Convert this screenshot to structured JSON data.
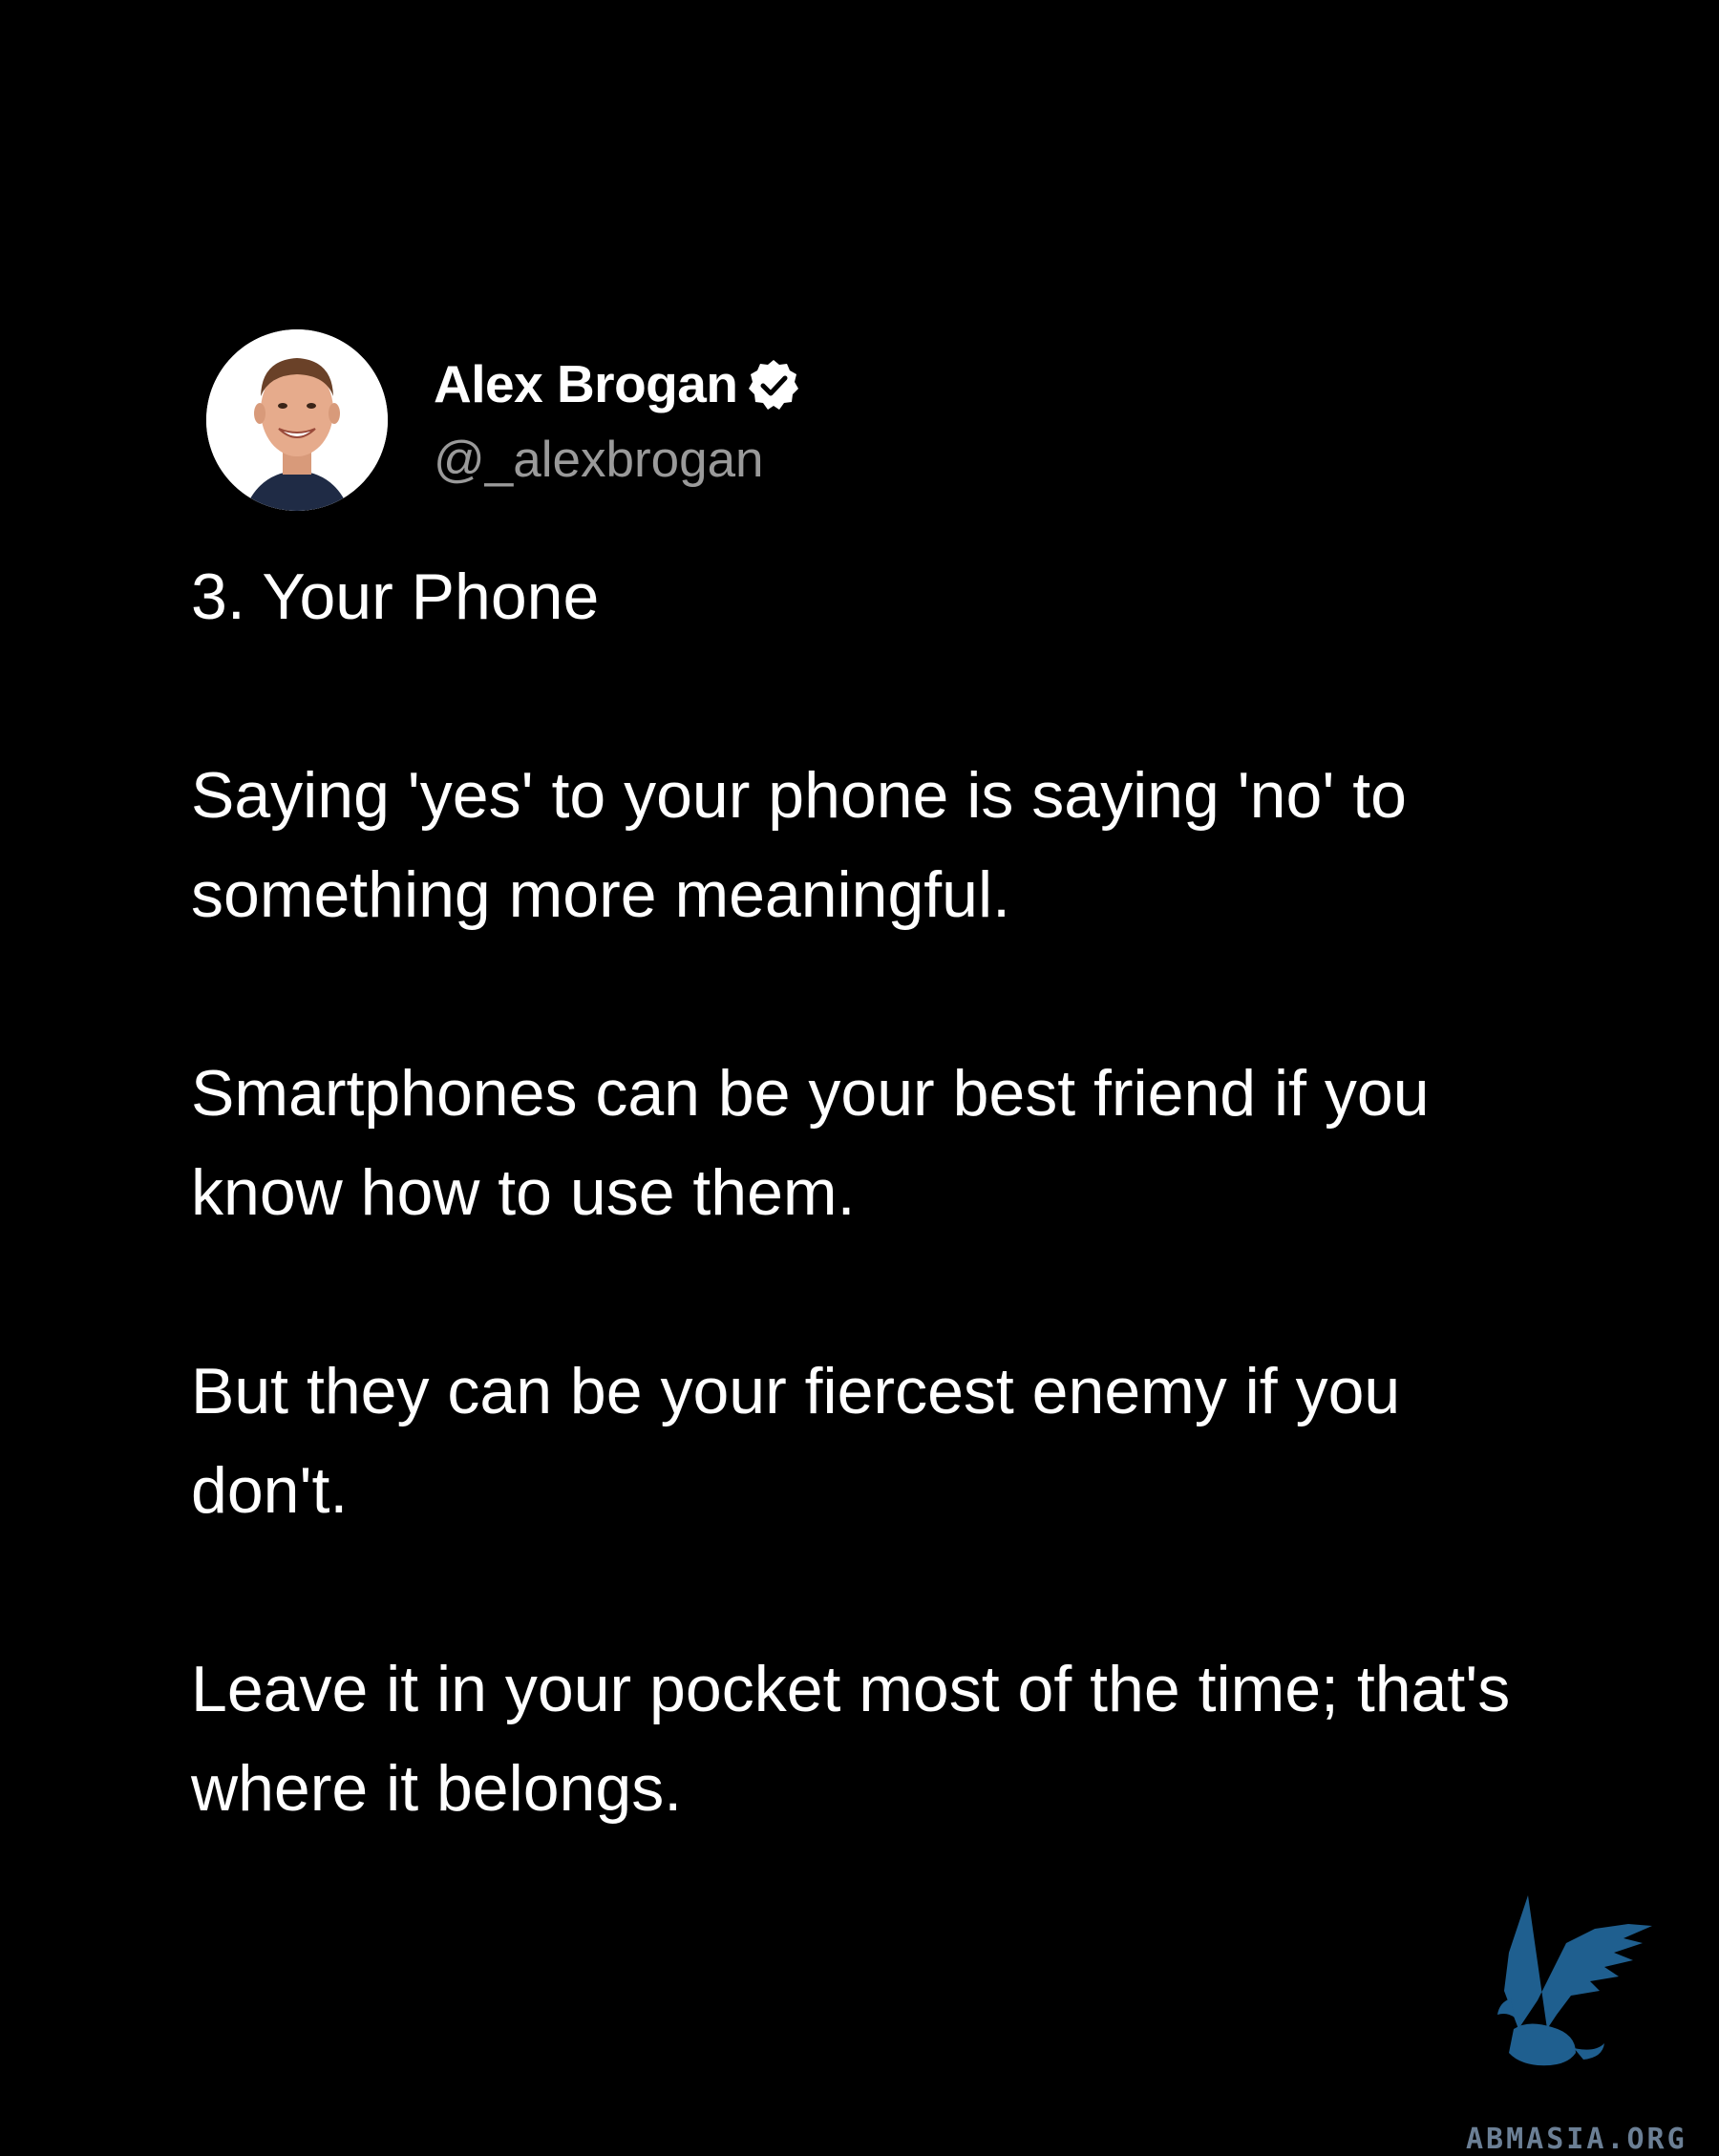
{
  "author": {
    "name": "Alex Brogan",
    "handle": "@_alexbrogan",
    "verified_icon": "verified-badge-icon",
    "avatar": "profile-photo"
  },
  "post": {
    "title": "3. Your Phone",
    "paragraphs": [
      "Saying 'yes' to your phone is saying 'no' to something more meaningful.",
      "Smartphones can be your best friend if you know how to use them.",
      "But they can be your fiercest enemy if you don't.",
      "Leave it in your pocket most of the time; that's where it belongs."
    ]
  },
  "watermark": {
    "text": "ABMASIA.ORG",
    "icon": "griffin-logo-icon"
  },
  "colors": {
    "background": "#000000",
    "text": "#ffffff",
    "handle": "#9a9a9a",
    "watermark": "#1f5f8f"
  }
}
